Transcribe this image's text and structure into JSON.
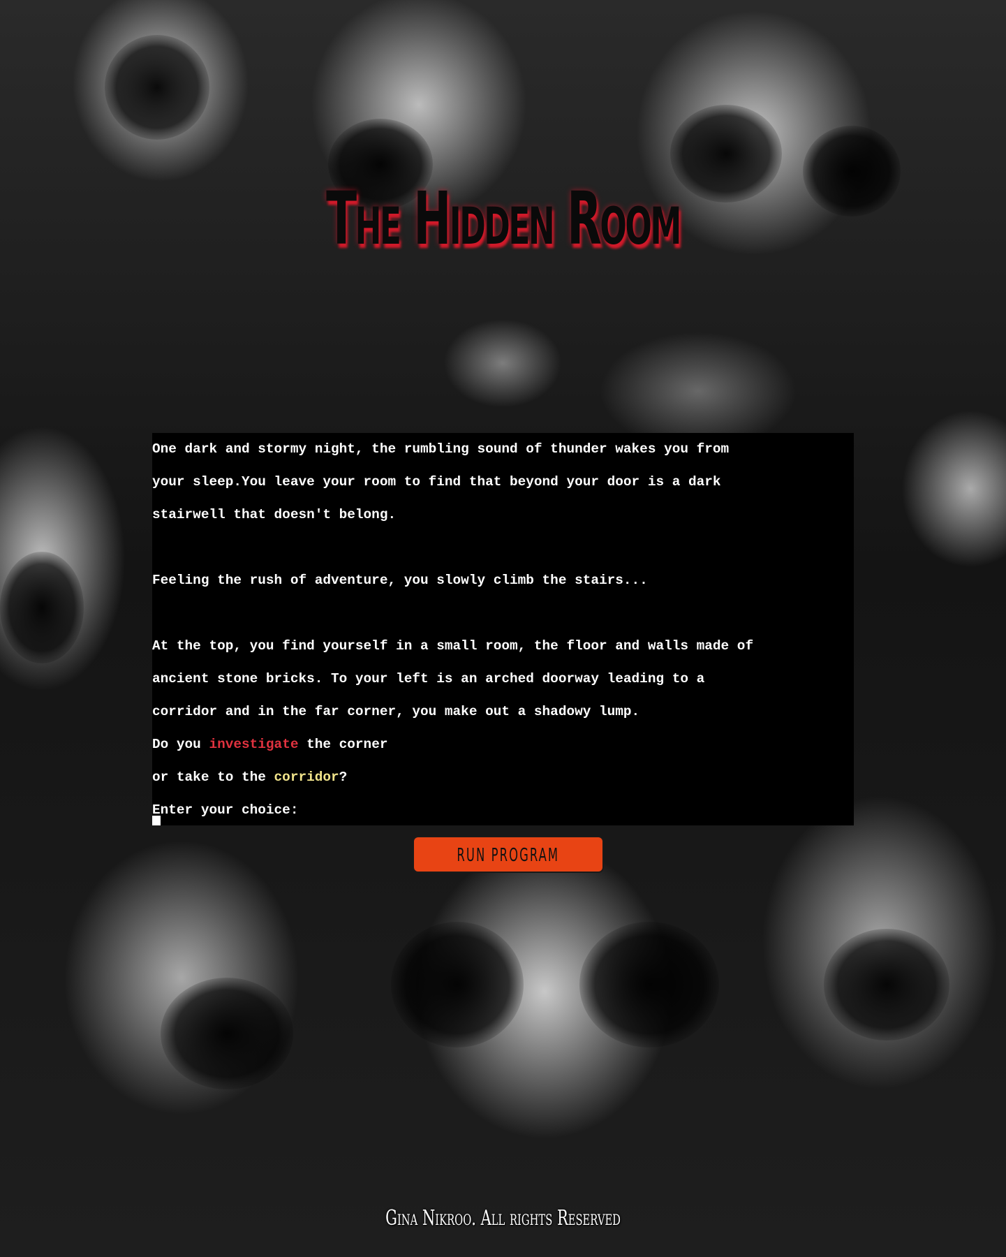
{
  "page": {
    "title": "The Hidden Room"
  },
  "terminal": {
    "lines": [
      "One dark and stormy night, the rumbling sound of thunder wakes you from",
      "your sleep.You leave your room to find that beyond your door is a dark",
      "stairwell that doesn't belong.",
      "",
      "Feeling the rush of adventure, you slowly climb the stairs...",
      "",
      "At the top, you find yourself in a small room, the floor and walls made of",
      "ancient stone bricks. To your left is an arched doorway leading to a",
      "corridor and in the far corner, you make out a shadowy lump."
    ],
    "choice_line_1": {
      "prefix": "Do you ",
      "highlight": "investigate",
      "suffix": " the corner"
    },
    "choice_line_2": {
      "prefix": "or take to the ",
      "highlight": "corridor",
      "suffix": "?"
    },
    "prompt": "Enter your choice:",
    "colors": {
      "investigate": "#e0323f",
      "corridor": "#f1e48b"
    }
  },
  "run_button": {
    "label": "RUN PROGRAM",
    "color": "#e84414"
  },
  "footer": {
    "text": "Gina Nikroo. All rights Reserved"
  }
}
